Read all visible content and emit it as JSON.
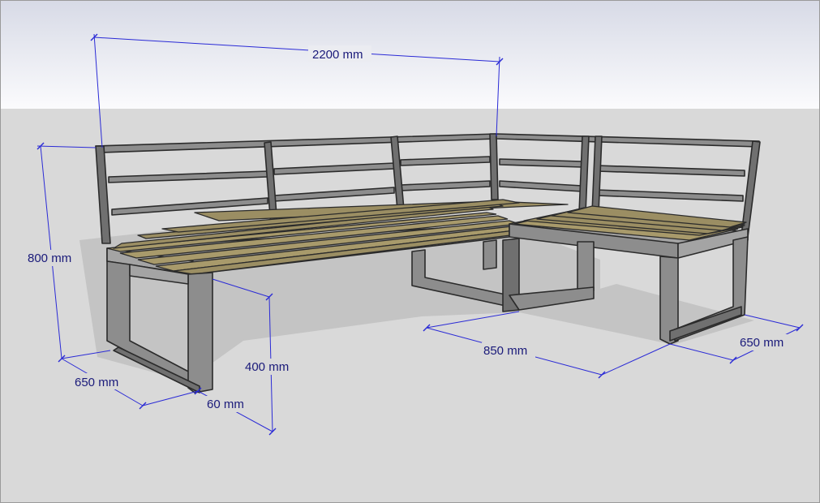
{
  "dimensions": {
    "overall_length": "2200 mm",
    "height": "800 mm",
    "depth_left": "650 mm",
    "seat_height": "400 mm",
    "frame_profile": "60 mm",
    "return_length": "850 mm",
    "depth_right": "650 mm"
  },
  "colors": {
    "sky_top": "#dfe1ec",
    "sky_bottom": "#ffffff",
    "ground": "#d9d9d9",
    "frame": "#8d8d8d",
    "wood": "#9b8e63",
    "dimension": "#2a2ad6"
  }
}
